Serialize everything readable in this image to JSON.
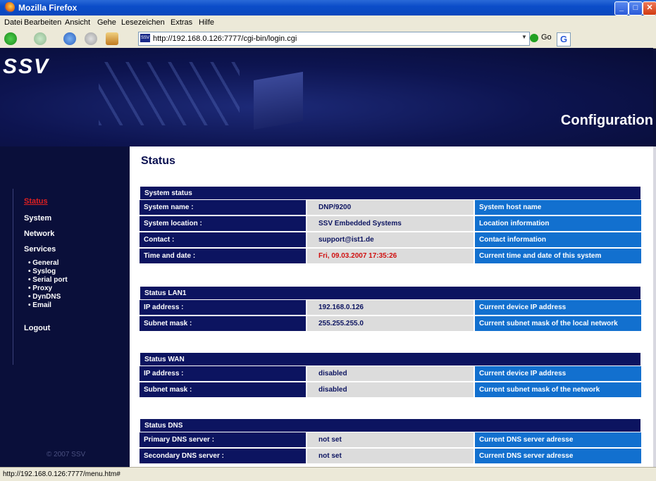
{
  "window": {
    "title": "Mozilla Firefox"
  },
  "menu": [
    "Datei",
    "Bearbeiten",
    "Ansicht",
    "Gehe",
    "Lesezeichen",
    "Extras",
    "Hilfe"
  ],
  "nav": {
    "url": "http://192.168.0.126:7777/cgi-bin/login.cgi",
    "favicon": "SSV",
    "go_label": "Go"
  },
  "banner": {
    "logo": "SSV",
    "heading": "Configuration"
  },
  "sidebar": {
    "items": [
      "Status",
      "System",
      "Network",
      "Services"
    ],
    "subitems": [
      "• General",
      "• Syslog",
      "• Serial port",
      "• Proxy",
      "• DynDNS",
      "• Email"
    ],
    "logout": "Logout",
    "copyright": "© 2007 SSV"
  },
  "page": {
    "title": "Status",
    "sections": [
      {
        "title": "System status",
        "rows": [
          [
            "System name :",
            "DNP/9200",
            "System host name"
          ],
          [
            "System location :",
            "SSV Embedded Systems",
            "Location information"
          ],
          [
            "Contact :",
            "support@ist1.de",
            "Contact information"
          ],
          [
            "Time and date :",
            "Fri, 09.03.2007 17:35:26",
            "Current time and date of this system"
          ]
        ]
      },
      {
        "title": "Status LAN1",
        "rows": [
          [
            "IP address :",
            "192.168.0.126",
            "Current device IP address"
          ],
          [
            "Subnet mask :",
            "255.255.255.0",
            "Current subnet mask of the local network"
          ]
        ]
      },
      {
        "title": "Status WAN",
        "rows": [
          [
            "IP address :",
            "disabled",
            "Current device IP address"
          ],
          [
            "Subnet mask :",
            "disabled",
            "Current subnet mask of the network"
          ]
        ]
      },
      {
        "title": "Status DNS",
        "rows": [
          [
            "Primary DNS server :",
            "not set",
            "Current DNS server adresse"
          ],
          [
            "Secondary DNS server :",
            "not set",
            "Current DNS server adresse"
          ]
        ]
      }
    ]
  },
  "status_bar": "http://192.168.0.126:7777/menu.htm#",
  "colors": {
    "accent_red": "#d01010",
    "header_navy": "#0c1460",
    "info_blue": "#1270cf"
  }
}
